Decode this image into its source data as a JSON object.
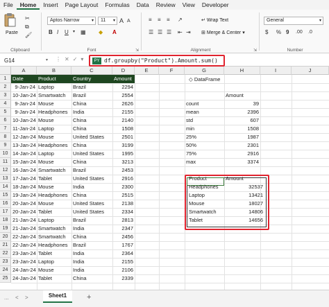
{
  "menu": [
    "File",
    "Home",
    "Insert",
    "Page Layout",
    "Formulas",
    "Data",
    "Review",
    "View",
    "Developer"
  ],
  "ribbon": {
    "paste_label": "Paste",
    "clipboard_label": "Clipboard",
    "font_label": "Font",
    "alignment_label": "Alignment",
    "number_label": "Number",
    "font_name": "Aptos Narrow",
    "font_size": "11",
    "bold": "B",
    "italic": "I",
    "underline": "U",
    "grow_font": "A",
    "shrink_font": "A",
    "font_color_glyph": "A",
    "wrap_text": "Wrap Text",
    "merge_center": "Merge & Center",
    "number_format": "General",
    "currency": "$",
    "percent": "%",
    "comma": "9"
  },
  "formula_bar": {
    "cell_ref": "G14",
    "py_badge": "PY",
    "formula": "df.groupby(\"Product\").Amount.sum()"
  },
  "columns": [
    "A",
    "B",
    "C",
    "D",
    "E",
    "F",
    "G",
    "H",
    "I",
    "J"
  ],
  "rows": [
    "1",
    "2",
    "3",
    "4",
    "5",
    "6",
    "7",
    "8",
    "9",
    "10",
    "11",
    "12",
    "13",
    "14",
    "15",
    "16",
    "17",
    "18",
    "19",
    "20",
    "21",
    "22",
    "23",
    "24",
    "25"
  ],
  "table": {
    "headers": [
      "Date",
      "Product",
      "Country",
      "Amount"
    ],
    "rows": [
      [
        "9-Jan-24",
        "Laptop",
        "Brazil",
        "2294"
      ],
      [
        "10-Jan-24",
        "Smartwatch",
        "Brazil",
        "2554"
      ],
      [
        "9-Jan-24",
        "Mouse",
        "China",
        "2626"
      ],
      [
        "9-Jan-24",
        "Headphones",
        "India",
        "2155"
      ],
      [
        "10-Jan-24",
        "Mouse",
        "China",
        "2140"
      ],
      [
        "11-Jan-24",
        "Laptop",
        "China",
        "1508"
      ],
      [
        "12-Jan-24",
        "Mouse",
        "United States",
        "2501"
      ],
      [
        "13-Jan-24",
        "Headphones",
        "China",
        "3199"
      ],
      [
        "14-Jan-24",
        "Laptop",
        "United States",
        "1995"
      ],
      [
        "15-Jan-24",
        "Mouse",
        "China",
        "3213"
      ],
      [
        "16-Jan-24",
        "Smartwatch",
        "Brazil",
        "2453"
      ],
      [
        "17-Jan-24",
        "Tablet",
        "United States",
        "2916"
      ],
      [
        "18-Jan-24",
        "Mouse",
        "India",
        "2300"
      ],
      [
        "19-Jan-24",
        "Headphones",
        "China",
        "2515"
      ],
      [
        "20-Jan-24",
        "Mouse",
        "United States",
        "2138"
      ],
      [
        "20-Jan-24",
        "Tablet",
        "United States",
        "2334"
      ],
      [
        "21-Jan-24",
        "Laptop",
        "Brazil",
        "2813"
      ],
      [
        "21-Jan-24",
        "Smartwatch",
        "India",
        "2347"
      ],
      [
        "22-Jan-24",
        "Smartwatch",
        "China",
        "2456"
      ],
      [
        "22-Jan-24",
        "Headphones",
        "Brazil",
        "1767"
      ],
      [
        "23-Jan-24",
        "Tablet",
        "India",
        "2364"
      ],
      [
        "23-Jan-24",
        "Laptop",
        "India",
        "2155"
      ],
      [
        "24-Jan-24",
        "Mouse",
        "India",
        "2106"
      ],
      [
        "24-Jan-24",
        "Tablet",
        "China",
        "2339"
      ]
    ]
  },
  "describe": {
    "label": "DataFrame",
    "column": "Amount",
    "stats": [
      [
        "count",
        "39"
      ],
      [
        "mean",
        "2396"
      ],
      [
        "std",
        "607"
      ],
      [
        "min",
        "1508"
      ],
      [
        "25%",
        "1987"
      ],
      [
        "50%",
        "2301"
      ],
      [
        "75%",
        "2916"
      ],
      [
        "max",
        "3374"
      ]
    ]
  },
  "groupby": {
    "headers": [
      "Product",
      "Amount"
    ],
    "rows": [
      [
        "Headphones",
        "32537"
      ],
      [
        "Laptop",
        "13421"
      ],
      [
        "Mouse",
        "18027"
      ],
      [
        "Smartwatch",
        "14806"
      ],
      [
        "Tablet",
        "14656"
      ]
    ]
  },
  "sheet": {
    "tab": "Sheet1",
    "add": "+",
    "prev": "<",
    "next": ">",
    "more": "..."
  },
  "colors": {
    "header_fill": "#1e4620",
    "accent_green": "#217346",
    "highlight_red": "#e0232e"
  }
}
